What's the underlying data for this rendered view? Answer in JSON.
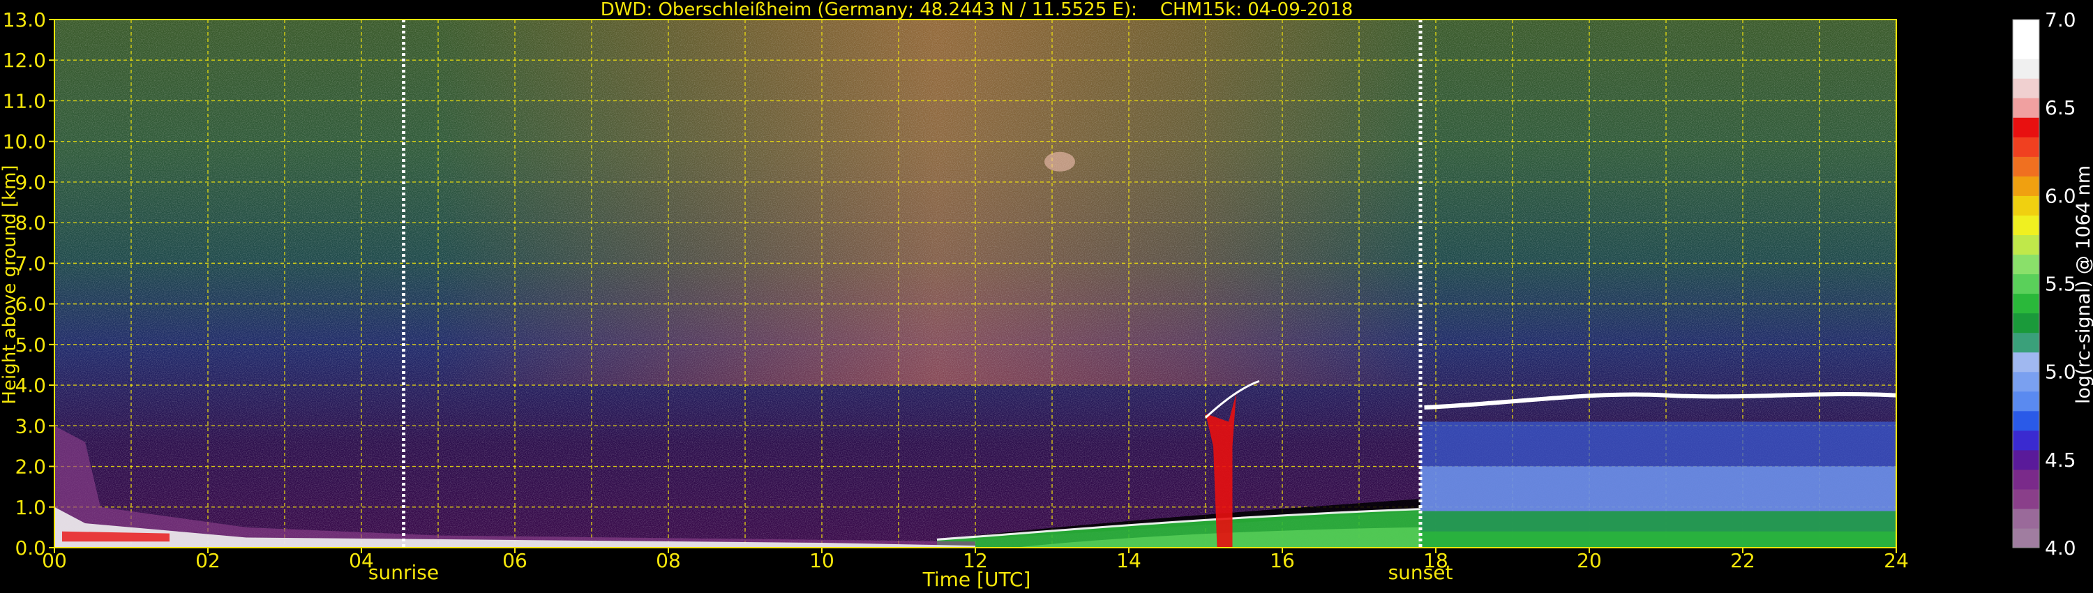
{
  "chart_data": {
    "type": "heatmap",
    "title": "DWD: Oberschleißheim (Germany; 48.2443 N / 11.5525 E):    CHM15k: 04-09-2018",
    "xlabel": "Time [UTC]",
    "ylabel": "Height above ground [km]",
    "xlim": [
      0,
      24
    ],
    "ylim": [
      0,
      13
    ],
    "x_ticks": [
      "00",
      "02",
      "04",
      "06",
      "08",
      "10",
      "12",
      "14",
      "16",
      "18",
      "20",
      "22",
      "24"
    ],
    "y_ticks": [
      "0.0",
      "1.0",
      "2.0",
      "3.0",
      "4.0",
      "5.0",
      "6.0",
      "7.0",
      "8.0",
      "9.0",
      "10.0",
      "11.0",
      "12.0",
      "13.0"
    ],
    "grid": true,
    "grid_color": "#f5e60a",
    "events": [
      {
        "label": "sunrise",
        "time": 4.55
      },
      {
        "label": "sunset",
        "time": 17.8
      }
    ],
    "colorbar": {
      "label": "log(rc-signal) @ 1064 nm",
      "range": [
        4.0,
        7.0
      ],
      "ticks": [
        "4.0",
        "4.5",
        "5.0",
        "5.5",
        "6.0",
        "6.5",
        "7.0"
      ],
      "colors": [
        "#a07da0",
        "#9a6a9a",
        "#8a3f8a",
        "#7a2a8a",
        "#5a1a9a",
        "#3a2ad0",
        "#2a5ae8",
        "#5a8af0",
        "#7aa0f0",
        "#a0b8f0",
        "#3aa07a",
        "#1a9a3a",
        "#2ab83a",
        "#5ad05a",
        "#8ae06a",
        "#c0e84a",
        "#f0f020",
        "#f0d010",
        "#f0a010",
        "#f07020",
        "#f04020",
        "#e81010",
        "#f0a0a0",
        "#f0d0d0",
        "#f0f0f0",
        "#ffffff",
        "#ffffff"
      ]
    },
    "features": [
      {
        "name": "boundary layer top",
        "time_start": 12.0,
        "time_end": 17.8,
        "height_start_km": 0.15,
        "height_end_km": 1.0
      },
      {
        "name": "convective plume",
        "time": 15.25,
        "height_top_km": 4.0
      },
      {
        "name": "elevated cloud layer",
        "time_start": 17.8,
        "time_end": 24.0,
        "height_km": 3.5
      },
      {
        "name": "residual aerosol layer",
        "time_start": 17.8,
        "time_end": 24.0,
        "height_top_km": 2.0
      },
      {
        "name": "cirrus patch",
        "time": 13.1,
        "height_km": 9.5
      }
    ]
  }
}
